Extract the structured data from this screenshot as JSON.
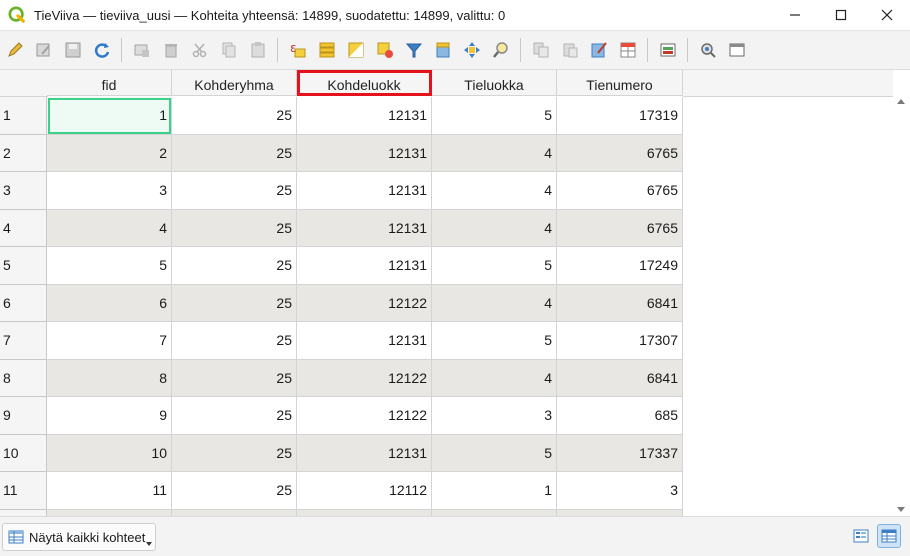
{
  "window": {
    "title": "TieViiva — tieviiva_uusi — Kohteita yhteensä: 14899, suodatettu: 14899, valittu: 0"
  },
  "toolbar": {
    "icons": [
      "toggle-editing-icon",
      "multi-edit-icon",
      "save-edits-icon",
      "reload-icon",
      "add-feature-icon",
      "delete-feature-icon",
      "cut-icon",
      "copy-icon",
      "paste-icon",
      "select-by-expression-icon",
      "select-all-icon",
      "invert-selection-icon",
      "deselect-all-icon",
      "filter-icon",
      "move-selection-to-top-icon",
      "pan-map-icon",
      "zoom-map-icon",
      "copy-rows-icon",
      "paste-rows-icon",
      "field-calculator-icon",
      "conditional-formatting-icon",
      "dock-table-icon",
      "actions-icon",
      "organize-columns-icon"
    ]
  },
  "table": {
    "columns": [
      "fid",
      "Kohderyhma",
      "Kohdeluokk",
      "Tieluokka",
      "Tienumero"
    ],
    "highlighted_column": "Kohdeluokk",
    "rows": [
      {
        "n": "1",
        "fid": "1",
        "kohderyhma": "25",
        "kohdeluokk": "12131",
        "tieluokka": "5",
        "tienumero": "17319"
      },
      {
        "n": "2",
        "fid": "2",
        "kohderyhma": "25",
        "kohdeluokk": "12131",
        "tieluokka": "4",
        "tienumero": "6765"
      },
      {
        "n": "3",
        "fid": "3",
        "kohderyhma": "25",
        "kohdeluokk": "12131",
        "tieluokka": "4",
        "tienumero": "6765"
      },
      {
        "n": "4",
        "fid": "4",
        "kohderyhma": "25",
        "kohdeluokk": "12131",
        "tieluokka": "4",
        "tienumero": "6765"
      },
      {
        "n": "5",
        "fid": "5",
        "kohderyhma": "25",
        "kohdeluokk": "12131",
        "tieluokka": "5",
        "tienumero": "17249"
      },
      {
        "n": "6",
        "fid": "6",
        "kohderyhma": "25",
        "kohdeluokk": "12122",
        "tieluokka": "4",
        "tienumero": "6841"
      },
      {
        "n": "7",
        "fid": "7",
        "kohderyhma": "25",
        "kohdeluokk": "12131",
        "tieluokka": "5",
        "tienumero": "17307"
      },
      {
        "n": "8",
        "fid": "8",
        "kohderyhma": "25",
        "kohdeluokk": "12122",
        "tieluokka": "4",
        "tienumero": "6841"
      },
      {
        "n": "9",
        "fid": "9",
        "kohderyhma": "25",
        "kohdeluokk": "12122",
        "tieluokka": "3",
        "tienumero": "685"
      },
      {
        "n": "10",
        "fid": "10",
        "kohderyhma": "25",
        "kohdeluokk": "12131",
        "tieluokka": "5",
        "tienumero": "17337"
      },
      {
        "n": "11",
        "fid": "11",
        "kohderyhma": "25",
        "kohdeluokk": "12112",
        "tieluokka": "1",
        "tienumero": "3"
      }
    ]
  },
  "statusbar": {
    "filter_label": "Näytä kaikki kohteet"
  },
  "colors": {
    "highlight_border": "#e3121c",
    "selected_cell_border": "#3cd08a",
    "alt_row": "#e9e7e3"
  }
}
